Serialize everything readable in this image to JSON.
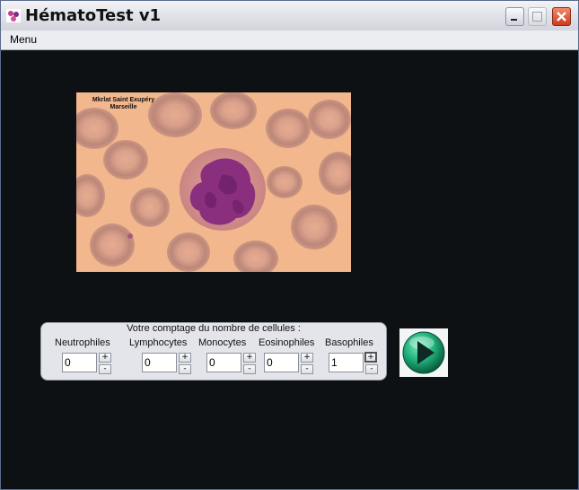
{
  "window": {
    "title": "HématoTest v1"
  },
  "menubar": {
    "menu_label": "Menu"
  },
  "image": {
    "watermark_line1": "Mkrlat Saint Exupéry",
    "watermark_line2": "Marseille"
  },
  "count_panel": {
    "title": "Votre comptage du nombre de cellules :",
    "cells": [
      {
        "label": "Neutrophiles",
        "value": "0",
        "plus": "+",
        "minus": "-"
      },
      {
        "label": "Lymphocytes",
        "value": "0",
        "plus": "+",
        "minus": "-"
      },
      {
        "label": "Monocytes",
        "value": "0",
        "plus": "+",
        "minus": "-"
      },
      {
        "label": "Eosinophiles",
        "value": "0",
        "plus": "+",
        "minus": "-"
      },
      {
        "label": "Basophiles",
        "value": "1",
        "plus": "+",
        "minus": "-"
      }
    ]
  },
  "icons": {
    "play": "play-icon",
    "app": "app-icon"
  },
  "colors": {
    "background": "#0d1113",
    "panel": "#e4e5ea",
    "play_green": "#1fb07a",
    "close_red": "#d9472a"
  }
}
